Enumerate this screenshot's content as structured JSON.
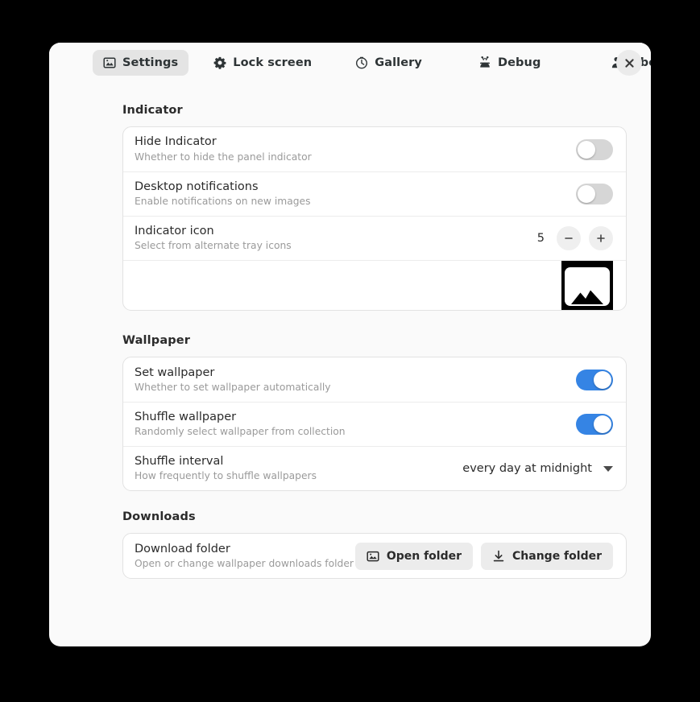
{
  "window": {
    "close_label": "×"
  },
  "tabs": [
    {
      "label": "Settings",
      "icon": "image-icon",
      "active": true
    },
    {
      "label": "Lock screen",
      "icon": "gear-icon",
      "active": false
    },
    {
      "label": "Gallery",
      "icon": "clock-icon",
      "active": false
    },
    {
      "label": "Debug",
      "icon": "bug-tools-icon",
      "active": false
    },
    {
      "label": "About",
      "icon": "person-info-icon",
      "active": false
    }
  ],
  "sections": {
    "indicator": {
      "title": "Indicator",
      "rows": [
        {
          "title": "Hide Indicator",
          "subtitle": "Whether to hide the panel indicator",
          "control": "toggle",
          "value": "off"
        },
        {
          "title": "Desktop notifications",
          "subtitle": "Enable notifications on new images",
          "control": "toggle",
          "value": "off"
        },
        {
          "title": "Indicator icon",
          "subtitle": "Select from alternate tray icons",
          "control": "stepper",
          "value": "5",
          "minus_label": "−",
          "plus_label": "+"
        }
      ],
      "preview": {
        "icon": "mountain-picture-icon"
      }
    },
    "wallpaper": {
      "title": "Wallpaper",
      "rows": [
        {
          "title": "Set wallpaper",
          "subtitle": "Whether to set wallpaper automatically",
          "control": "toggle",
          "value": "on"
        },
        {
          "title": "Shuffle wallpaper",
          "subtitle": "Randomly select wallpaper from collection",
          "control": "toggle",
          "value": "on"
        },
        {
          "title": "Shuffle interval",
          "subtitle": "How frequently to shuffle wallpapers",
          "control": "dropdown",
          "value": "every day at midnight"
        }
      ]
    },
    "downloads": {
      "title": "Downloads",
      "rows": [
        {
          "title": "Download folder",
          "subtitle": "Open or change wallpaper downloads folder",
          "control": "buttons",
          "buttons": [
            {
              "label": "Open folder",
              "icon": "image-icon"
            },
            {
              "label": "Change folder",
              "icon": "download-icon"
            }
          ]
        }
      ]
    }
  },
  "colors": {
    "accent": "#3584e4",
    "window_bg": "#fafafa",
    "card_bg": "#ffffff",
    "toggle_off": "#d6d6d6",
    "desktop_bg": "#000000"
  }
}
